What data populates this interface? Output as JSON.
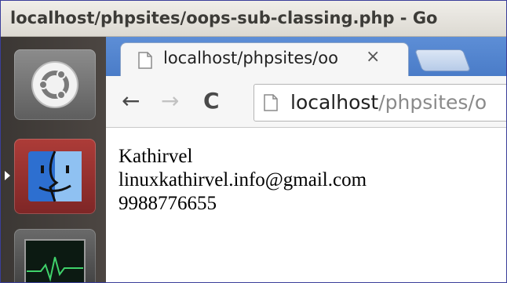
{
  "window": {
    "title": "localhost/phpsites/oops-sub-classing.php - Go"
  },
  "launcher": {
    "items": [
      "ubuntu-icon",
      "finder-icon",
      "system-monitor-icon"
    ]
  },
  "browser": {
    "tab": {
      "title": "localhost/phpsites/oo",
      "close": "×"
    },
    "toolbar": {
      "back": "←",
      "forward": "→",
      "reload": "C"
    },
    "address": {
      "host": "localhost",
      "path": "/phpsites/o"
    }
  },
  "page": {
    "lines": [
      "Kathirvel",
      "linuxkathirvel.info@gmail.com",
      "9988776655"
    ]
  }
}
